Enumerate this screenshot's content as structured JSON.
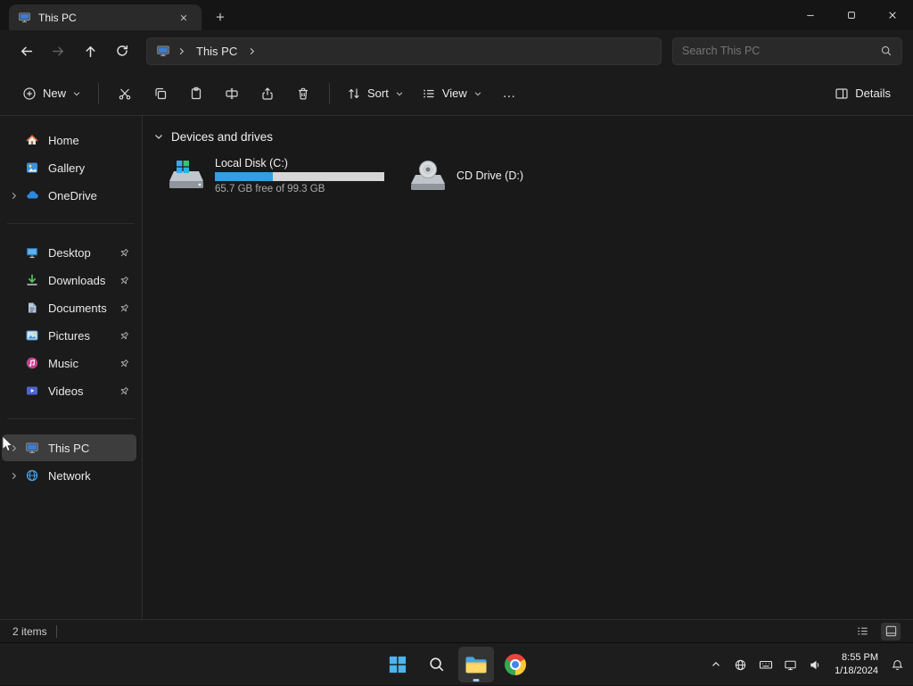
{
  "titlebar": {
    "tab_title": "This PC"
  },
  "navbar": {
    "breadcrumb_root": "This PC",
    "search_placeholder": "Search This PC"
  },
  "toolbar": {
    "new_label": "New",
    "sort_label": "Sort",
    "view_label": "View",
    "more_label": "…",
    "details_label": "Details"
  },
  "sidebar": {
    "items": [
      {
        "label": "Home",
        "pinned": false
      },
      {
        "label": "Gallery",
        "pinned": false
      },
      {
        "label": "OneDrive",
        "pinned": false,
        "expandable": true
      },
      {
        "label": "Desktop",
        "pinned": true
      },
      {
        "label": "Downloads",
        "pinned": true
      },
      {
        "label": "Documents",
        "pinned": true
      },
      {
        "label": "Pictures",
        "pinned": true
      },
      {
        "label": "Music",
        "pinned": true
      },
      {
        "label": "Videos",
        "pinned": true
      },
      {
        "label": "This PC",
        "pinned": false,
        "expandable": true,
        "selected": true
      },
      {
        "label": "Network",
        "pinned": false,
        "expandable": true
      }
    ]
  },
  "main": {
    "section_header": "Devices and drives",
    "drives": [
      {
        "name": "Local Disk (C:)",
        "free_text": "65.7 GB free of 99.3 GB",
        "usage_percent": 34
      },
      {
        "name": "CD Drive (D:)"
      }
    ]
  },
  "statusbar": {
    "count": "2 items"
  },
  "taskbar": {
    "clock": {
      "time": "8:55 PM",
      "date": "1/18/2024"
    }
  },
  "colors": {
    "accent": "#31a0dc",
    "usage_track": "#d6d6d6",
    "selection": "#3d3d3d"
  }
}
